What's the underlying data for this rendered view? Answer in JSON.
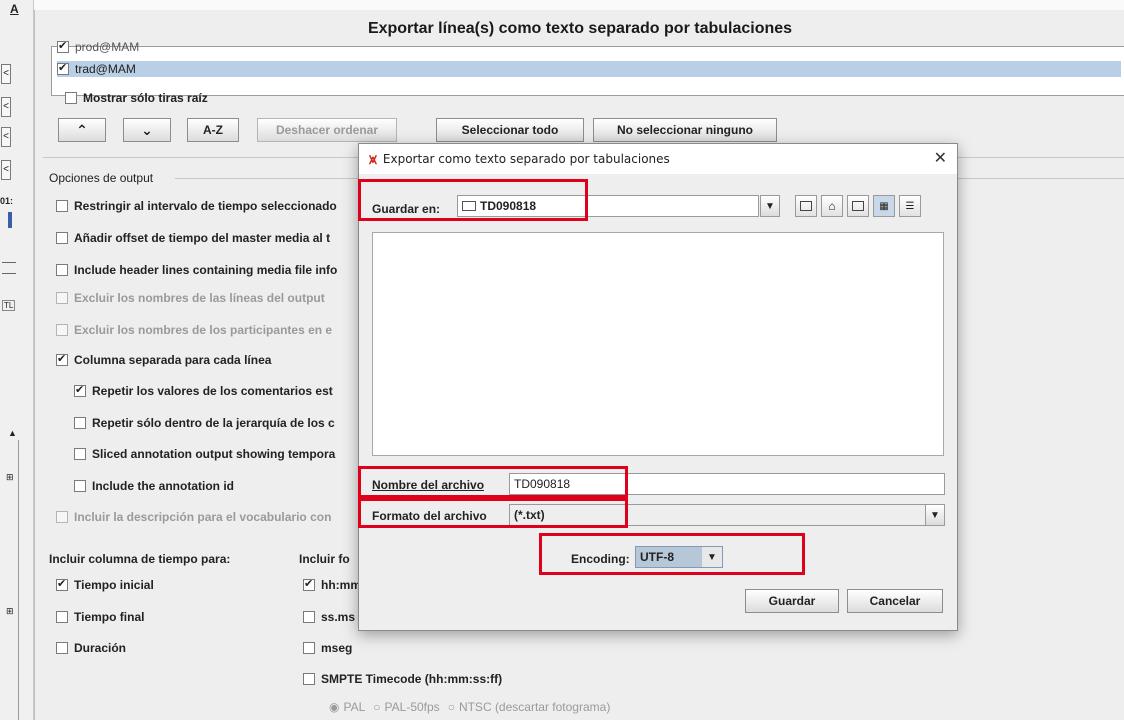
{
  "background_app": {
    "menu_fragment": "A",
    "tab_fragment_a": "01:",
    "tab_fragment_b": "TL"
  },
  "main_dialog": {
    "title": "Exportar línea(s) como texto separado por tabulaciones",
    "tiers": [
      {
        "name": "prod@MAM",
        "checked": true,
        "selected": false
      },
      {
        "name": "trad@MAM",
        "checked": true,
        "selected": true
      }
    ],
    "show_root_label": "Mostrar sólo tiras raíz",
    "buttons": {
      "move_up": "⌃",
      "move_down": "⌄",
      "sort_az": "A-Z",
      "undo_sort": "Deshacer ordenar",
      "select_all": "Seleccionar todo",
      "select_none": "No seleccionar ninguno"
    },
    "output_options_title": "Opciones de output",
    "options": [
      {
        "label": "Restringir al intervalo de tiempo seleccionado",
        "checked": false,
        "disabled": false
      },
      {
        "label": "Añadir offset de tiempo del master media al t",
        "checked": false,
        "disabled": false
      },
      {
        "label": "Include header lines containing media file info",
        "checked": false,
        "disabled": false
      },
      {
        "label": "Excluir los nombres de las líneas del output",
        "checked": false,
        "disabled": true
      },
      {
        "label": "Excluir los nombres de los participantes en e",
        "checked": false,
        "disabled": true
      },
      {
        "label": "Columna separada para cada línea",
        "checked": true,
        "disabled": false
      },
      {
        "label": "Repetir los valores de los comentarios est",
        "checked": true,
        "disabled": false
      },
      {
        "label": "Repetir sólo dentro de la jerarquía de los c",
        "checked": false,
        "disabled": false
      },
      {
        "label": "Sliced annotation output showing tempora",
        "checked": false,
        "disabled": false
      },
      {
        "label": "Include the annotation id",
        "checked": false,
        "disabled": false
      },
      {
        "label": "Incluir la descripción para el vocabulario con",
        "checked": false,
        "disabled": true
      }
    ],
    "time_column_title": "Incluir columna de tiempo para:",
    "time_columns": [
      {
        "label": "Tiempo inicial",
        "checked": true
      },
      {
        "label": "Tiempo final",
        "checked": false
      },
      {
        "label": "Duración",
        "checked": false
      }
    ],
    "format_title": "Incluir fo",
    "formats": [
      {
        "label": "hh:mm",
        "checked": true
      },
      {
        "label": "ss.ms",
        "checked": false
      },
      {
        "label": "mseg",
        "checked": false
      },
      {
        "label": "SMPTE Timecode (hh:mm:ss:ff)",
        "checked": false
      }
    ],
    "smpte_radios": [
      {
        "label": "PAL",
        "selected": true
      },
      {
        "label": "PAL-50fps",
        "selected": false
      },
      {
        "label": "NTSC (descartar fotograma)",
        "selected": false
      }
    ]
  },
  "file_chooser": {
    "title": "Exportar como texto separado por tabulaciones",
    "save_in_label": "Guardar en:",
    "save_in_value": "TD090818",
    "file_name_label": "Nombre del archivo",
    "file_name_value": "TD090818",
    "file_format_label": "Formato del archivo",
    "file_format_value": "(*.txt)",
    "encoding_label": "Encoding:",
    "encoding_value": "UTF-8",
    "save_button": "Guardar",
    "cancel_button": "Cancelar",
    "colors": {
      "highlight_box": "#e1001c",
      "selection": "#b8cfe5"
    }
  }
}
